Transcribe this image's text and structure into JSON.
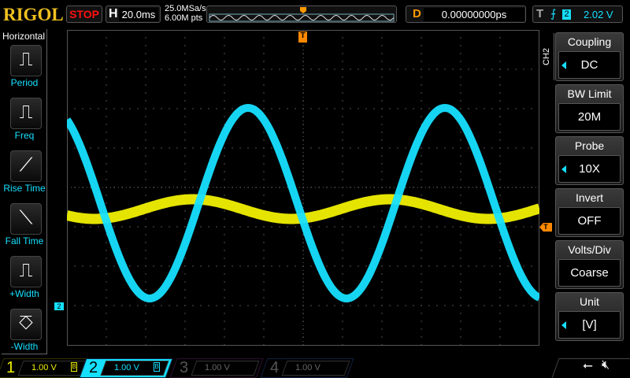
{
  "header": {
    "logo": "RIGOL",
    "run_state": "STOP",
    "timebase_label": "H",
    "timebase": "20.0ms",
    "sample_rate": "25.0MSa/s",
    "memory_depth": "6.00M pts",
    "delay_label": "D",
    "delay": "0.00000000ps",
    "trigger_label": "T",
    "trigger_source": "2",
    "trigger_level": "2.02 V"
  },
  "left_menu": {
    "title": "Horizontal",
    "items": [
      {
        "label": "Period",
        "icon": "period-icon"
      },
      {
        "label": "Freq",
        "icon": "freq-icon"
      },
      {
        "label": "Rise Time",
        "icon": "rise-time-icon"
      },
      {
        "label": "Fall Time",
        "icon": "fall-time-icon"
      },
      {
        "label": "+Width",
        "icon": "pos-width-icon"
      },
      {
        "label": "-Width",
        "icon": "neg-width-icon"
      }
    ]
  },
  "right_menu": {
    "channel": "CH2",
    "items": [
      {
        "label": "Coupling",
        "value": "DC"
      },
      {
        "label": "BW Limit",
        "value": "20M"
      },
      {
        "label": "Probe",
        "value": "10X"
      },
      {
        "label": "Invert",
        "value": "OFF"
      },
      {
        "label": "Volts/Div",
        "value": "Coarse"
      },
      {
        "label": "Unit",
        "value": "[V]"
      }
    ]
  },
  "channels": [
    {
      "num": "1",
      "scale": "1.00 V",
      "color": "#f0f000",
      "active": true
    },
    {
      "num": "2",
      "scale": "1.00 V",
      "color": "#16e0ff",
      "active": true
    },
    {
      "num": "3",
      "scale": "1.00 V",
      "color": "#c020c0",
      "active": false
    },
    {
      "num": "4",
      "scale": "1.00 V",
      "color": "#2080ff",
      "active": false
    }
  ],
  "markers": {
    "trigger": "T",
    "ch2_ground": "2"
  },
  "waveforms": {
    "grid_divisions": [
      12,
      8
    ],
    "ch1": {
      "color": "#f0f000",
      "amplitude_div": 0.25,
      "offset_div": -0.55,
      "period_div": 5,
      "phase_peak_div": -2.8
    },
    "ch2": {
      "color": "#16e0ff",
      "amplitude_div": 2.42,
      "offset_div": -0.4,
      "period_div": 5,
      "phase_peak_div": -1.4
    }
  }
}
